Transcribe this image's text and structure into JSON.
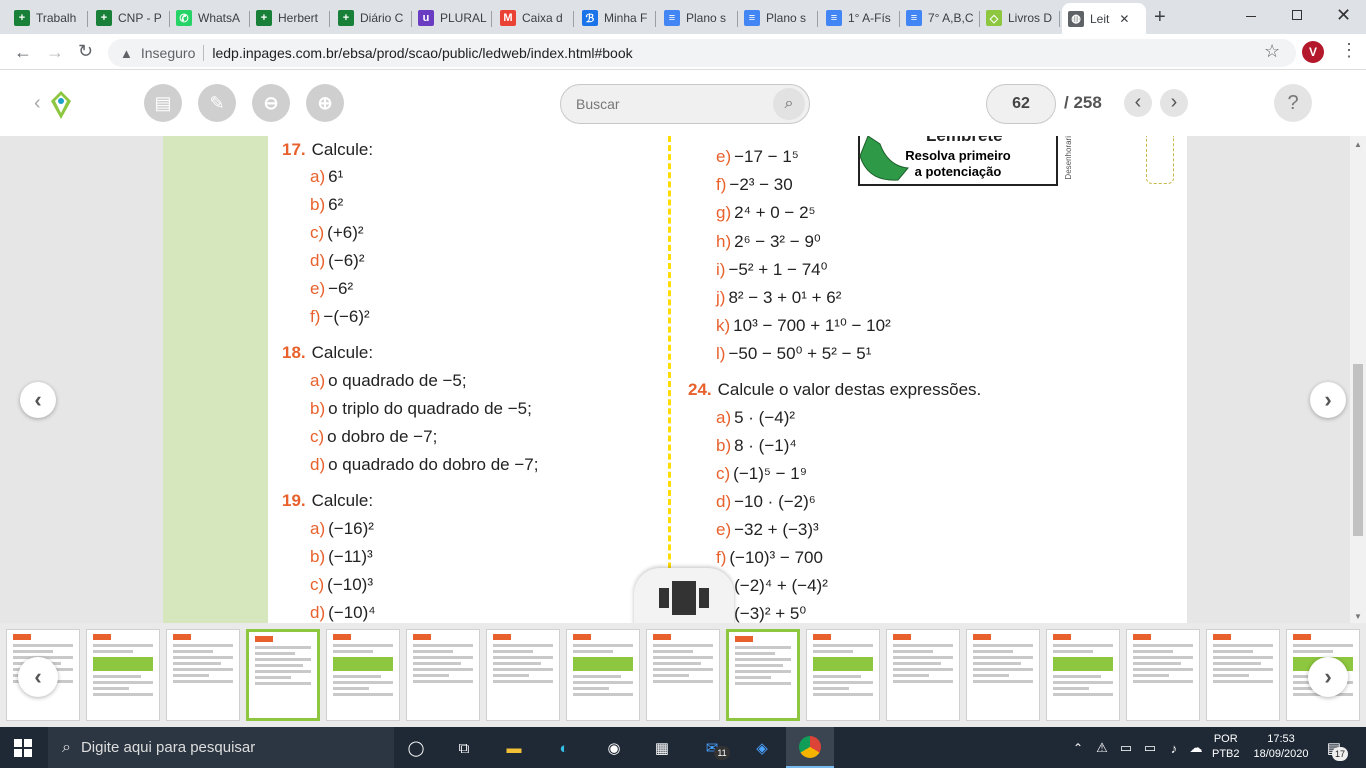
{
  "browser": {
    "tabs": [
      {
        "label": "Trabalh",
        "color": "#188038",
        "glyph": "+"
      },
      {
        "label": "CNP - P",
        "color": "#188038",
        "glyph": "+"
      },
      {
        "label": "WhatsA",
        "color": "#25d366",
        "glyph": "✆"
      },
      {
        "label": "Herbert",
        "color": "#188038",
        "glyph": "+"
      },
      {
        "label": "Diário C",
        "color": "#188038",
        "glyph": "+"
      },
      {
        "label": "PLURAL",
        "color": "#6a3cc2",
        "glyph": "u"
      },
      {
        "label": "Caixa d",
        "color": "#ea4335",
        "glyph": "M"
      },
      {
        "label": "Minha F",
        "color": "#1a73e8",
        "glyph": "ℬ"
      },
      {
        "label": "Plano s",
        "color": "#4285f4",
        "glyph": "≡"
      },
      {
        "label": "Plano s",
        "color": "#4285f4",
        "glyph": "≡"
      },
      {
        "label": "1° A-Fís",
        "color": "#4285f4",
        "glyph": "≡"
      },
      {
        "label": "7° A,B,C",
        "color": "#4285f4",
        "glyph": "≡"
      },
      {
        "label": "Livros D",
        "color": "#8dc63f",
        "glyph": "◇"
      },
      {
        "label": "Leit",
        "color": "#5f6368",
        "glyph": "◍"
      }
    ],
    "new_tab": "+",
    "security_label": "Inseguro",
    "url": "ledp.inpages.com.br/ebsa/prod/scao/public/ledweb/index.html#book",
    "profile_initial": "V"
  },
  "viewer": {
    "search_placeholder": "Buscar",
    "current_page": "62",
    "total_pages": "/ 258",
    "help": "?"
  },
  "book": {
    "q17": {
      "num": "17.",
      "title": "Calcule:",
      "items": [
        {
          "l": "a)",
          "t": "6¹"
        },
        {
          "l": "b)",
          "t": "6²"
        },
        {
          "l": "c)",
          "t": "(+6)²"
        },
        {
          "l": "d)",
          "t": "(−6)²"
        },
        {
          "l": "e)",
          "t": "−6²"
        },
        {
          "l": "f)",
          "t": "−(−6)²"
        }
      ]
    },
    "q18": {
      "num": "18.",
      "title": "Calcule:",
      "items": [
        {
          "l": "a)",
          "t": "o quadrado de −5;"
        },
        {
          "l": "b)",
          "t": "o triplo do quadrado de −5;"
        },
        {
          "l": "c)",
          "t": "o dobro de −7;"
        },
        {
          "l": "d)",
          "t": "o quadrado do dobro de −7;"
        }
      ]
    },
    "q19": {
      "num": "19.",
      "title": "Calcule:",
      "items": [
        {
          "l": "a)",
          "t": "(−16)²"
        },
        {
          "l": "b)",
          "t": "(−11)³"
        },
        {
          "l": "c)",
          "t": "(−10)³"
        },
        {
          "l": "d)",
          "t": "(−10)⁴"
        }
      ]
    },
    "q23_items": [
      {
        "l": "e)",
        "t": "−17 − 1⁵"
      },
      {
        "l": "f)",
        "t": "−2³ − 30"
      },
      {
        "l": "g)",
        "t": "2⁴ + 0 − 2⁵"
      },
      {
        "l": "h)",
        "t": "2⁶ − 3² − 9⁰"
      },
      {
        "l": "i)",
        "t": "−5² + 1 − 74⁰"
      },
      {
        "l": "j)",
        "t": "8² − 3 + 0¹ + 6²"
      },
      {
        "l": "k)",
        "t": "10³ − 700 + 1¹⁰ − 10²"
      },
      {
        "l": "l)",
        "t": "−50 − 50⁰ + 5² − 5¹"
      }
    ],
    "lembrete": {
      "title": "Lembrete",
      "line1": "Resolva primeiro",
      "line2": "a potenciação",
      "credit": "Desenhorari"
    },
    "q24": {
      "num": "24.",
      "title": "Calcule o valor destas expressões.",
      "items": [
        {
          "l": "a)",
          "t": "5 · (−4)²"
        },
        {
          "l": "b)",
          "t": "8 · (−1)⁴"
        },
        {
          "l": "c)",
          "t": "(−1)⁵ − 1⁹"
        },
        {
          "l": "d)",
          "t": "−10 · (−2)⁶"
        },
        {
          "l": "e)",
          "t": "−32 + (−3)³"
        },
        {
          "l": "f)",
          "t": "(−10)³ − 700"
        },
        {
          "l": "g)",
          "t": "(−2)⁴ + (−4)²"
        },
        {
          "l": "h)",
          "t": "(−3)² + 5⁰"
        }
      ]
    }
  },
  "taskbar": {
    "search_placeholder": "Digite aqui para pesquisar",
    "lang1": "POR",
    "lang2": "PTB2",
    "time": "17:53",
    "date": "18/09/2020",
    "mail_count": "11",
    "notif_count": "17"
  }
}
